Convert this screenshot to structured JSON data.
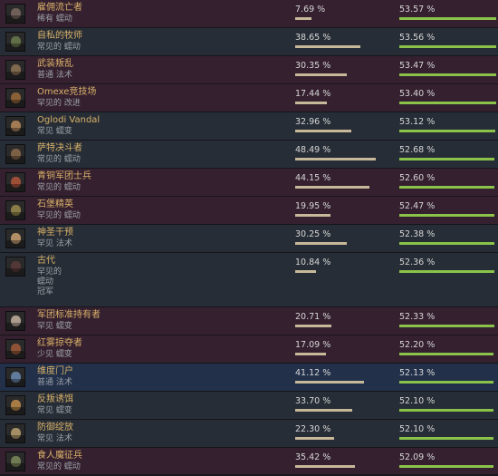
{
  "colors": {
    "name_gold": "#d9b26a",
    "desc_gray": "#9aa0a6",
    "pick_bar": "#c7b89a",
    "win_bar": "#8bc34a"
  },
  "rows": [
    {
      "name": "雇佣流亡者",
      "desc": [
        "稀有",
        "蠕动"
      ],
      "pick": "7.69 %",
      "pick_value": 7.69,
      "win": "53.57 %",
      "win_value": 53.57,
      "tone": "purple",
      "portrait_color": "#7a6a62",
      "icon": "hero-portrait"
    },
    {
      "name": "自私的牧师",
      "desc": [
        "常见的",
        "蠕动"
      ],
      "pick": "38.65 %",
      "pick_value": 38.65,
      "win": "53.56 %",
      "win_value": 53.56,
      "tone": "gray",
      "portrait_color": "#6b7a4e",
      "icon": "hero-portrait"
    },
    {
      "name": "武装叛乱",
      "desc": [
        "普通",
        "法术"
      ],
      "pick": "30.35 %",
      "pick_value": 30.35,
      "win": "53.47 %",
      "win_value": 53.47,
      "tone": "purple",
      "portrait_color": "#8d7355",
      "icon": "hero-portrait"
    },
    {
      "name": "Omexe竞技场",
      "desc": [
        "罕见的",
        "改进"
      ],
      "pick": "17.44 %",
      "pick_value": 17.44,
      "win": "53.40 %",
      "win_value": 53.4,
      "tone": "purple",
      "portrait_color": "#9a6a3a",
      "icon": "hero-portrait"
    },
    {
      "name": "Oglodi Vandal",
      "desc": [
        "常见",
        "蠕变"
      ],
      "pick": "32.96 %",
      "pick_value": 32.96,
      "win": "53.12 %",
      "win_value": 53.12,
      "tone": "gray",
      "portrait_color": "#b58a5a",
      "icon": "hero-portrait"
    },
    {
      "name": "萨特决斗者",
      "desc": [
        "常见的",
        "蠕动"
      ],
      "pick": "48.49 %",
      "pick_value": 48.49,
      "win": "52.68 %",
      "win_value": 52.68,
      "tone": "gray",
      "portrait_color": "#8a6a4a",
      "icon": "hero-portrait"
    },
    {
      "name": "青铜军团士兵",
      "desc": [
        "常见的",
        "蠕动"
      ],
      "pick": "44.15 %",
      "pick_value": 44.15,
      "win": "52.60 %",
      "win_value": 52.6,
      "tone": "purple",
      "portrait_color": "#b0553a",
      "icon": "hero-portrait"
    },
    {
      "name": "石堡精英",
      "desc": [
        "罕见的",
        "蠕动"
      ],
      "pick": "19.95 %",
      "pick_value": 19.95,
      "win": "52.47 %",
      "win_value": 52.47,
      "tone": "purple",
      "portrait_color": "#9a8a4a",
      "icon": "hero-portrait"
    },
    {
      "name": "神圣干预",
      "desc": [
        "罕见",
        "法术"
      ],
      "pick": "30.25 %",
      "pick_value": 30.25,
      "win": "52.38 %",
      "win_value": 52.38,
      "tone": "gray",
      "portrait_color": "#c9a070",
      "icon": "hero-portrait"
    },
    {
      "name": "古代",
      "desc": [
        "罕见的",
        "蠕动",
        "冠军"
      ],
      "pick": "10.84 %",
      "pick_value": 10.84,
      "win": "52.36 %",
      "win_value": 52.36,
      "tone": "gray",
      "portrait_color": "#5a3a3a",
      "icon": "hero-portrait"
    },
    {
      "name": "军团标准持有者",
      "desc": [
        "罕见",
        "蠕变"
      ],
      "pick": "20.71 %",
      "pick_value": 20.71,
      "win": "52.33 %",
      "win_value": 52.33,
      "tone": "purple",
      "portrait_color": "#c2b0a0",
      "icon": "hero-portrait"
    },
    {
      "name": "红雾掠夺者",
      "desc": [
        "少见",
        "蠕变"
      ],
      "pick": "17.09 %",
      "pick_value": 17.09,
      "win": "52.20 %",
      "win_value": 52.2,
      "tone": "purple",
      "portrait_color": "#a05a3a",
      "icon": "hero-portrait"
    },
    {
      "name": "维度门户",
      "desc": [
        "普通",
        "法术"
      ],
      "pick": "41.12 %",
      "pick_value": 41.12,
      "win": "52.13 %",
      "win_value": 52.13,
      "tone": "blue",
      "portrait_color": "#6a8ab0",
      "icon": "hero-portrait"
    },
    {
      "name": "反叛诱饵",
      "desc": [
        "常见",
        "蠕变"
      ],
      "pick": "33.70 %",
      "pick_value": 33.7,
      "win": "52.10 %",
      "win_value": 52.1,
      "tone": "gray",
      "portrait_color": "#c08a4a",
      "icon": "hero-portrait"
    },
    {
      "name": "防御绽放",
      "desc": [
        "常见",
        "法术"
      ],
      "pick": "22.30 %",
      "pick_value": 22.3,
      "win": "52.10 %",
      "win_value": 52.1,
      "tone": "gray",
      "portrait_color": "#b8a070",
      "icon": "hero-portrait"
    },
    {
      "name": "食人魔征兵",
      "desc": [
        "常见的",
        "蠕动"
      ],
      "pick": "35.42 %",
      "pick_value": 35.42,
      "win": "52.09 %",
      "win_value": 52.09,
      "tone": "purple",
      "portrait_color": "#7a8a5a",
      "icon": "hero-portrait"
    }
  ]
}
